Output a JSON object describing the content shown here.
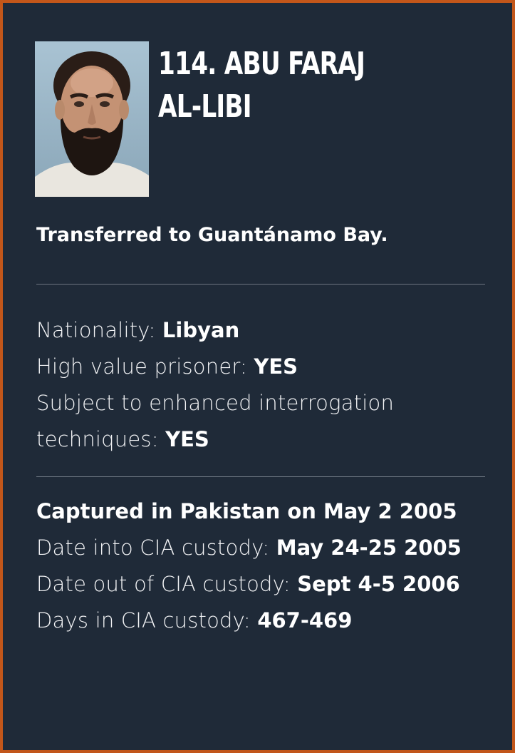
{
  "profile": {
    "title_line1": "114. ABU FARAJ",
    "title_line2": "AL-LIBI",
    "status": "Transferred to Guantánamo Bay."
  },
  "details": {
    "nationality_label": "Nationality: ",
    "nationality_value": "Libyan",
    "high_value_label": "High value prisoner: ",
    "high_value_value": "YES",
    "eit_label_line1": "Subject to enhanced interrogation",
    "eit_label_line2": "techniques: ",
    "eit_value": "YES"
  },
  "custody": {
    "captured": "Captured in Pakistan on May 2 2005",
    "date_into_label": "Date into CIA custody: ",
    "date_into_value": "May 24-25 2005",
    "date_out_label": "Date out of CIA custody: ",
    "date_out_value": "Sept 4-5 2006",
    "days_label": "Days in CIA custody: ",
    "days_value": "467-469"
  },
  "colors": {
    "background": "#1f2a38",
    "border": "#c2561a",
    "text": "#ffffff",
    "rule": "#6b7480"
  }
}
